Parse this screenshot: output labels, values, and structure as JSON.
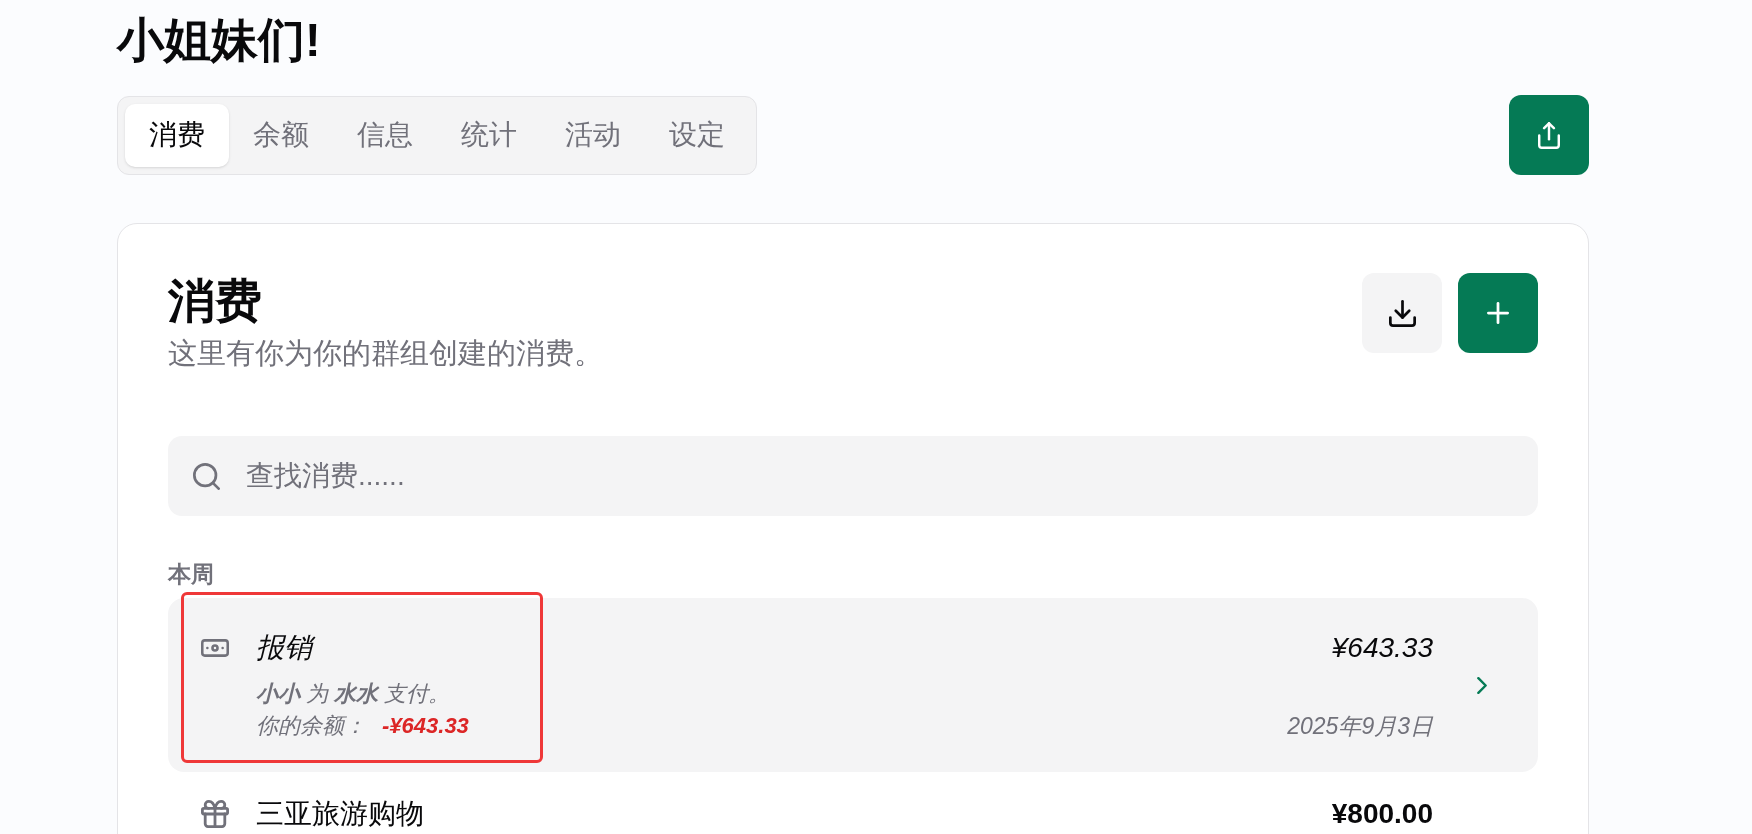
{
  "page": {
    "title": "小姐妹们!"
  },
  "tabs": [
    {
      "label": "消费",
      "selected": true
    },
    {
      "label": "余额",
      "selected": false
    },
    {
      "label": "信息",
      "selected": false
    },
    {
      "label": "统计",
      "selected": false
    },
    {
      "label": "活动",
      "selected": false
    },
    {
      "label": "设定",
      "selected": false
    }
  ],
  "expenses": {
    "title": "消费",
    "subtitle": "这里有你为你的群组创建的消费。",
    "search": {
      "placeholder": "查找消费......"
    },
    "groups": [
      {
        "label": "本周",
        "items": [
          {
            "kind": "reimbursement",
            "selected": true,
            "highlighted": true,
            "title": "报销",
            "summary": "**小小** 为 **水水** 支付。",
            "balance_label": "你的余额：",
            "balance": "-¥643.33",
            "balance_negative": true,
            "amount": "¥643.33",
            "date": "2025年9月3日"
          },
          {
            "kind": "expense",
            "selected": false,
            "highlighted": false,
            "title": "三亚旅游购物",
            "amount": "¥800.00"
          }
        ]
      }
    ]
  }
}
